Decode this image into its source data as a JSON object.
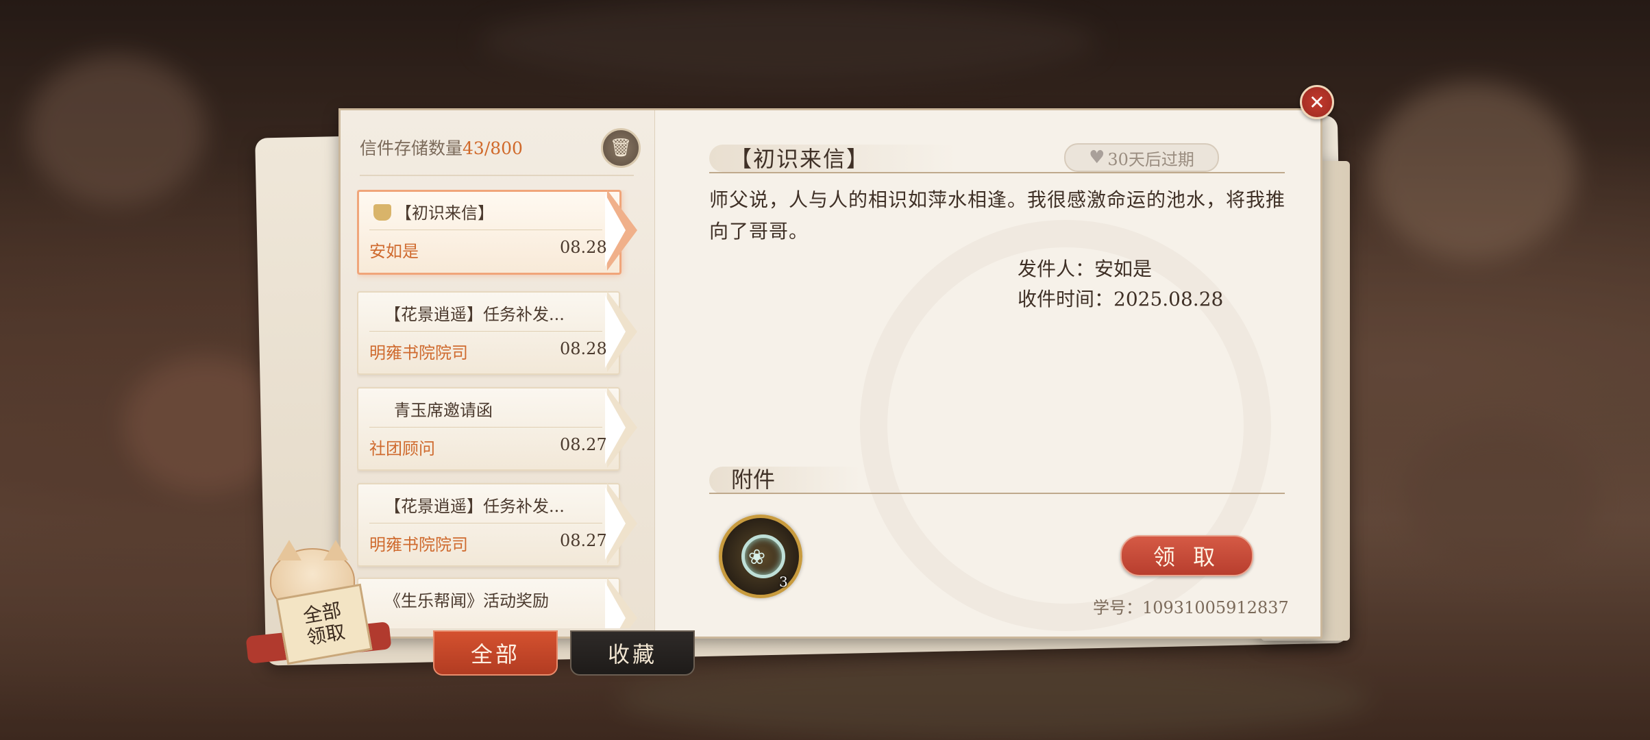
{
  "storage": {
    "label": "信件存储数量",
    "count": "43/800"
  },
  "mails": [
    {
      "title": "【初识来信】",
      "sender": "安如是",
      "date": "08.28",
      "active": true
    },
    {
      "title": "【花景逍遥】任务补发...",
      "sender": "明雍书院院司",
      "date": "08.28"
    },
    {
      "title": "青玉席邀请函",
      "sender": "社团顾问",
      "date": "08.27"
    },
    {
      "title": "【花景逍遥】任务补发...",
      "sender": "明雍书院院司",
      "date": "08.27"
    },
    {
      "title": "《生乐帮闻》活动奖励",
      "sender": "",
      "date": ""
    }
  ],
  "detail": {
    "title": "【初识来信】",
    "expire": "30天后过期",
    "body": "师父说，人与人的相识如萍水相逢。我很感激命运的池水，将我推向了哥哥。",
    "sender_line": "发件人：安如是",
    "time_line": "收件时间：2025.08.28",
    "attachment_label": "附件",
    "attachment_count": "3",
    "claim_label": "领 取",
    "student_id": "学号：10931005912837"
  },
  "tabs": {
    "all": "全部",
    "favorites": "收藏"
  },
  "claim_all": {
    "line1": "全部",
    "line2": "领取"
  },
  "close": "✕",
  "colors": {
    "accent": "#cf6a2e",
    "claim": "#c04a36"
  }
}
